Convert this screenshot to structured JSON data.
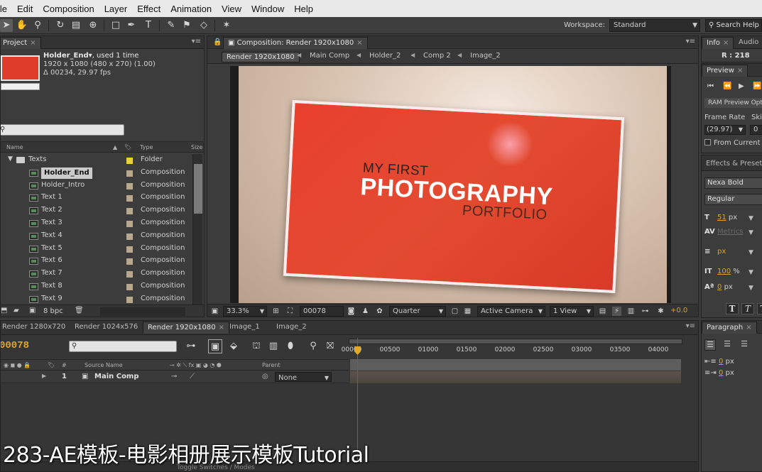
{
  "menu": [
    "ile",
    "Edit",
    "Composition",
    "Layer",
    "Effect",
    "Animation",
    "View",
    "Window",
    "Help"
  ],
  "toolbar": {
    "workspace_label": "Workspace:",
    "workspace_value": "Standard",
    "search_help": "Search Help"
  },
  "project": {
    "tab": "Project",
    "selected_name": "Holder_End",
    "selected_used": ", used 1 time",
    "selected_dims": "1920 x 1080  (480 x 270) (1.00)",
    "selected_duration": "Δ 00234, 29.97 fps",
    "columns": {
      "name": "Name",
      "type": "Type",
      "size": "Size"
    },
    "rows": [
      {
        "name": "Texts",
        "type": "Folder",
        "folder": true,
        "label_color": "#e8d23a"
      },
      {
        "name": "Holder_End",
        "type": "Composition",
        "selected": true,
        "label_color": "#b8a890"
      },
      {
        "name": "Holder_Intro",
        "type": "Composition",
        "label_color": "#b8a890"
      },
      {
        "name": "Text 1",
        "type": "Composition",
        "label_color": "#b8a890"
      },
      {
        "name": "Text 2",
        "type": "Composition",
        "label_color": "#b8a890"
      },
      {
        "name": "Text 3",
        "type": "Composition",
        "label_color": "#b8a890"
      },
      {
        "name": "Text 4",
        "type": "Composition",
        "label_color": "#b8a890"
      },
      {
        "name": "Text 5",
        "type": "Composition",
        "label_color": "#b8a890"
      },
      {
        "name": "Text 6",
        "type": "Composition",
        "label_color": "#b8a890"
      },
      {
        "name": "Text 7",
        "type": "Composition",
        "label_color": "#b8a890"
      },
      {
        "name": "Text 8",
        "type": "Composition",
        "label_color": "#b8a890"
      },
      {
        "name": "Text 9",
        "type": "Composition",
        "label_color": "#b8a890"
      }
    ],
    "bpc": "8 bpc"
  },
  "composition": {
    "tab": "Composition: Render 1920x1080",
    "breadcrumbs": [
      "Render 1920x1080",
      "Main Comp",
      "Holder_2",
      "Comp 2",
      "Image_2"
    ],
    "card_line1": "MY FIRST",
    "card_line2": "PHOTOGRAPHY",
    "card_line3": "PORTFOLIO",
    "zoom": "33.3%",
    "timecode": "00078",
    "resolution": "Quarter",
    "camera": "Active Camera",
    "views": "1 View",
    "exposure": "+0.0"
  },
  "info": {
    "tab1": "Info",
    "tab2": "Audio",
    "r_label": "R : 218"
  },
  "preview": {
    "tab": "Preview",
    "ram_preview": "RAM Preview Options",
    "frame_rate_label": "Frame Rate",
    "skip_label": "Skip",
    "frame_rate_value": "(29.97)",
    "skip_value": "0",
    "from_current": "From Current Time"
  },
  "character": {
    "tab": "Effects & Presets",
    "font": "Nexa Bold",
    "style": "Regular",
    "size": "51",
    "size_unit": "px",
    "kerning": "Metrics",
    "stroke_unit": "px",
    "vscale": "100",
    "vscale_unit": "%",
    "baseline": "0",
    "baseline_unit": "px"
  },
  "timeline": {
    "tabs": [
      "Render 1280x720",
      "Render 1024x576",
      "Render 1920x1080",
      "Image_1",
      "Image_2"
    ],
    "time": "00078",
    "ticks": [
      "00000",
      "00500",
      "01000",
      "01500",
      "02000",
      "02500",
      "03000",
      "03500",
      "04000"
    ],
    "columns": {
      "source_name": "Source Name",
      "parent": "Parent"
    },
    "layer": {
      "index": "1",
      "name": "Main Comp",
      "parent": "None"
    },
    "toggle": "Toggle Switches / Modes"
  },
  "paragraph": {
    "tab": "Paragraph",
    "indent1": "0",
    "indent2": "0",
    "unit": "px"
  },
  "caption": "283-AE模板-电影相册展示模板Tutorial"
}
